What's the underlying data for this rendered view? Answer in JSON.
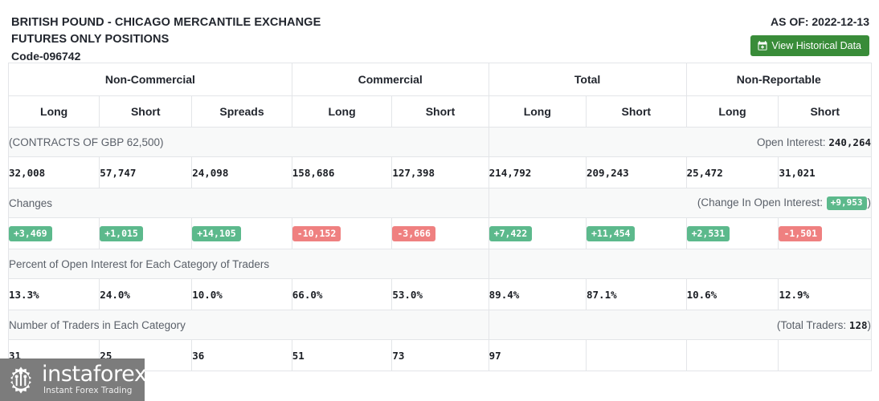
{
  "header": {
    "title_line1": "BRITISH POUND - CHICAGO MERCANTILE EXCHANGE",
    "title_line2": "FUTURES ONLY POSITIONS",
    "code": "Code-096742",
    "as_of": "AS OF: 2022-12-13",
    "historical_button": "View Historical Data",
    "calendar_icon": "calendar-plus-icon"
  },
  "table": {
    "groups": [
      {
        "label": "Non-Commercial",
        "span": 3
      },
      {
        "label": "Commercial",
        "span": 2
      },
      {
        "label": "Total",
        "span": 2
      },
      {
        "label": "Non-Reportable",
        "span": 2
      }
    ],
    "columns": [
      "Long",
      "Short",
      "Spreads",
      "Long",
      "Short",
      "Long",
      "Short",
      "Long",
      "Short"
    ],
    "contracts_label": "(CONTRACTS OF GBP 62,500)",
    "open_interest_label": "Open Interest:",
    "open_interest_value": "240,264",
    "positions": [
      "32,008",
      "57,747",
      "24,098",
      "158,686",
      "127,398",
      "214,792",
      "209,243",
      "25,472",
      "31,021"
    ],
    "changes_label": "Changes",
    "change_oi_prefix": "(Change In Open Interest:",
    "change_oi_value": "+9,953",
    "change_oi_suffix": ")",
    "changes": [
      {
        "value": "+3,469",
        "dir": "up"
      },
      {
        "value": "+1,015",
        "dir": "up"
      },
      {
        "value": "+14,105",
        "dir": "up"
      },
      {
        "value": "-10,152",
        "dir": "down"
      },
      {
        "value": "-3,666",
        "dir": "down"
      },
      {
        "value": "+7,422",
        "dir": "up"
      },
      {
        "value": "+11,454",
        "dir": "up"
      },
      {
        "value": "+2,531",
        "dir": "up"
      },
      {
        "value": "-1,501",
        "dir": "down"
      }
    ],
    "percent_label": "Percent of Open Interest for Each Category of Traders",
    "percents": [
      "13.3%",
      "24.0%",
      "10.0%",
      "66.0%",
      "53.0%",
      "89.4%",
      "87.1%",
      "10.6%",
      "12.9%"
    ],
    "traders_label": "Number of Traders in Each Category",
    "total_traders_prefix": "(Total Traders:",
    "total_traders_value": "128",
    "total_traders_suffix": ")",
    "traders": [
      "31",
      "25",
      "36",
      "51",
      "73",
      "97",
      "",
      ""
    ]
  },
  "watermark": {
    "name": "instaforex",
    "tagline": "Instant Forex Trading",
    "logo_icon": "instaforex-gear-logo"
  }
}
